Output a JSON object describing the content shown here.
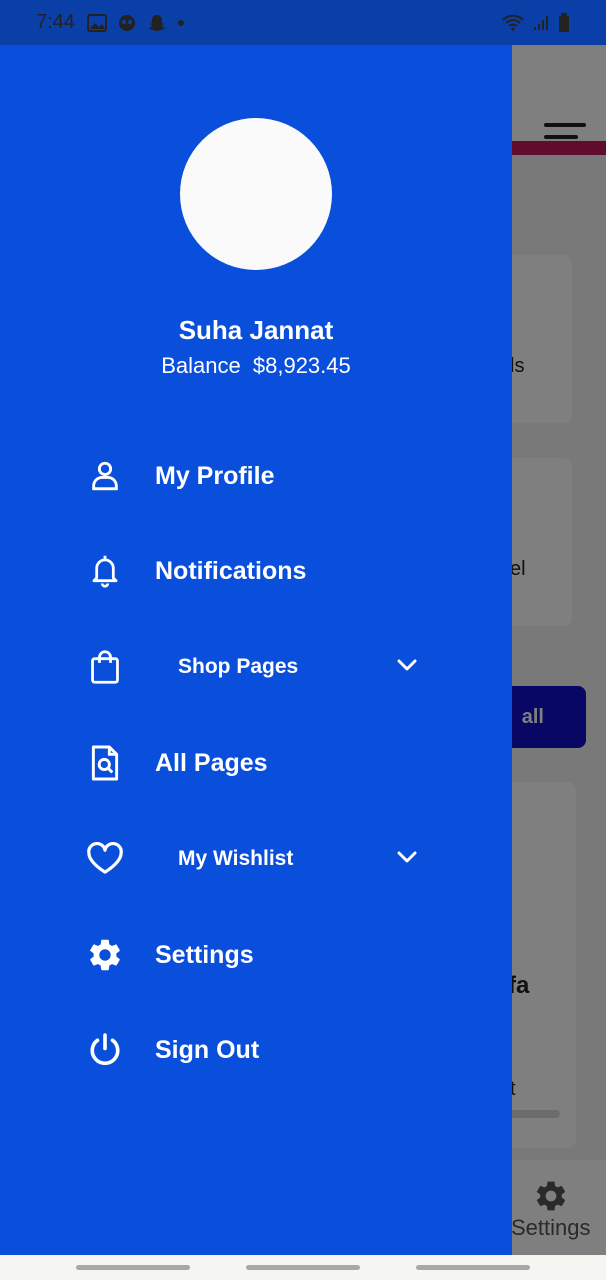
{
  "status_bar": {
    "time": "7:44"
  },
  "user": {
    "name": "Suha Jannat",
    "balance_label": "Balance",
    "balance_value": "$8,923.45"
  },
  "menu": [
    {
      "label": "My Profile",
      "icon": "user-icon"
    },
    {
      "label": "Notifications",
      "icon": "bell-icon"
    },
    {
      "label": "Shop Pages",
      "icon": "shopping-bag-icon",
      "expandable": true
    },
    {
      "label": "All Pages",
      "icon": "file-search-icon"
    },
    {
      "label": "My Wishlist",
      "icon": "heart-icon",
      "expandable": true
    },
    {
      "label": "Settings",
      "icon": "gear-icon"
    },
    {
      "label": "Sign Out",
      "icon": "power-icon"
    }
  ],
  "background": {
    "card1_text": "ls",
    "card2_text": "el",
    "view_all_label": "all",
    "product_title": "fa",
    "product_sub": "t",
    "bottom_nav_settings": "Settings"
  },
  "colors": {
    "drawer": "#0a4fdb",
    "status_bar": "#0a3fa8",
    "accent": "#c2185b",
    "view_all_button": "#1010c8"
  }
}
